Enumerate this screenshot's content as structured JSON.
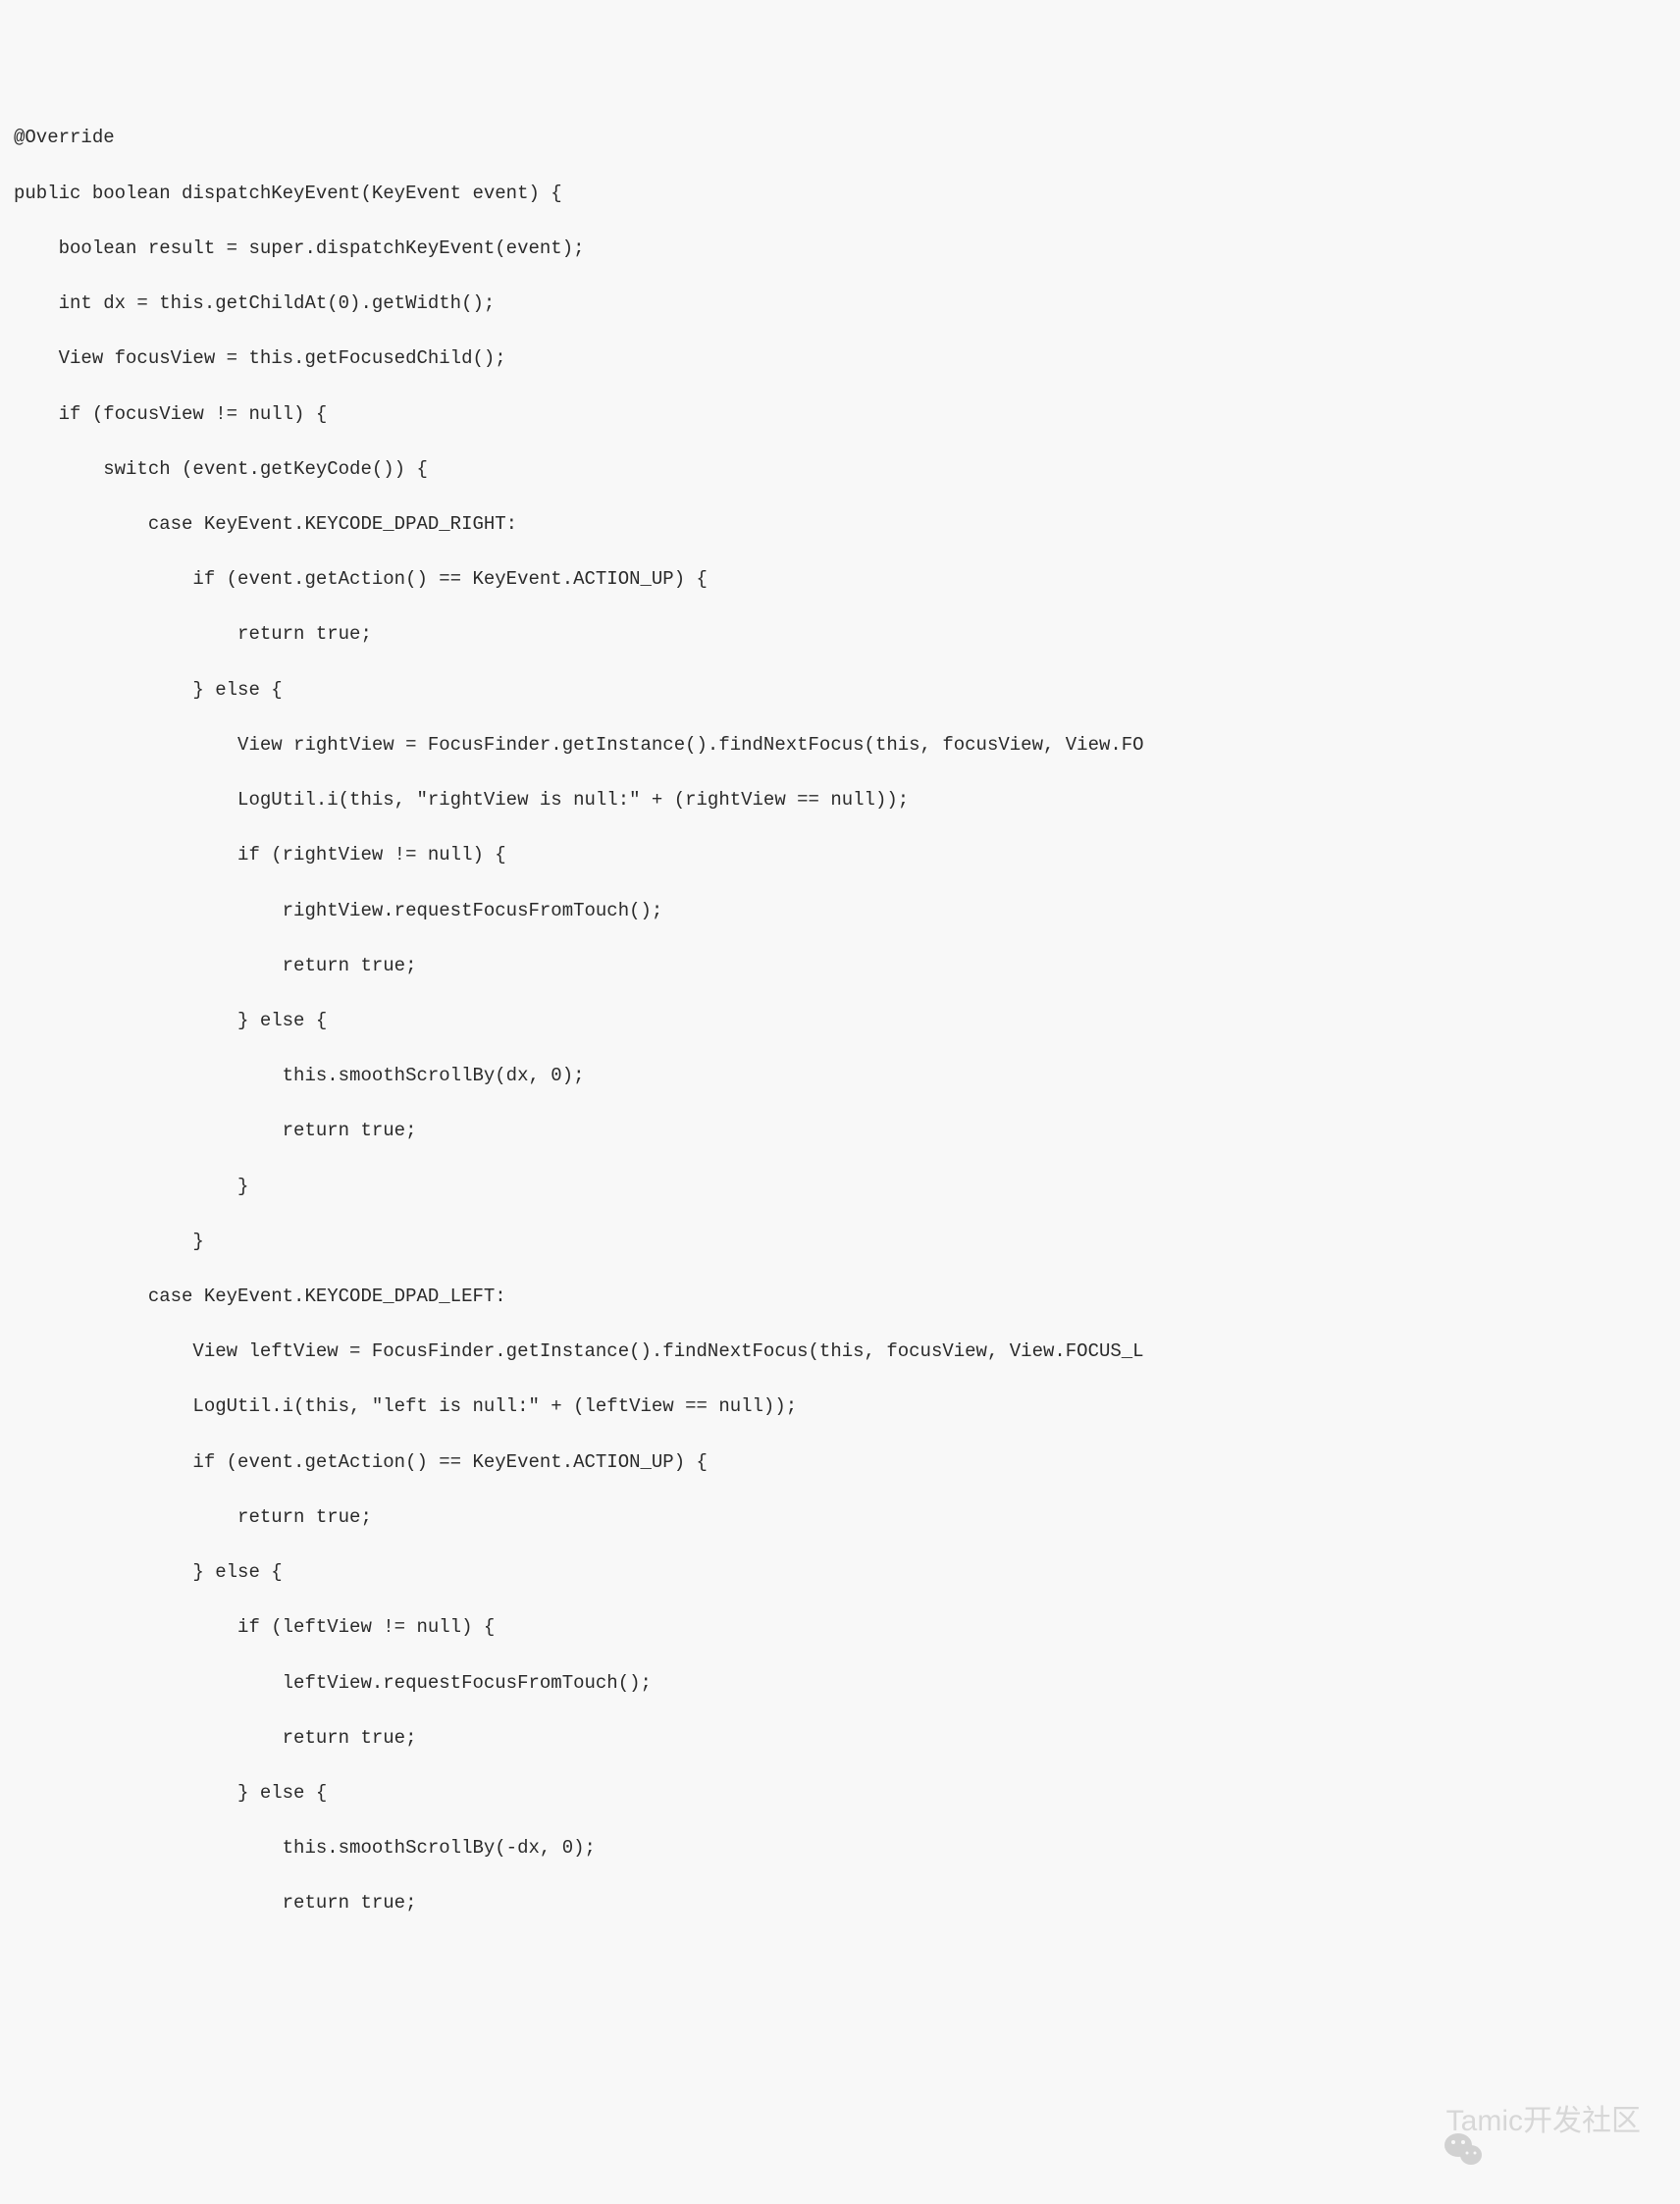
{
  "code": {
    "lines": [
      "@Override",
      "public boolean dispatchKeyEvent(KeyEvent event) {",
      "    boolean result = super.dispatchKeyEvent(event);",
      "    int dx = this.getChildAt(0).getWidth();",
      "    View focusView = this.getFocusedChild();",
      "    if (focusView != null) {",
      "        switch (event.getKeyCode()) {",
      "            case KeyEvent.KEYCODE_DPAD_RIGHT:",
      "                if (event.getAction() == KeyEvent.ACTION_UP) {",
      "                    return true;",
      "                } else {",
      "                    View rightView = FocusFinder.getInstance().findNextFocus(this, focusView, View.FO",
      "                    LogUtil.i(this, \"rightView is null:\" + (rightView == null));",
      "                    if (rightView != null) {",
      "                        rightView.requestFocusFromTouch();",
      "                        return true;",
      "                    } else {",
      "                        this.smoothScrollBy(dx, 0);",
      "                        return true;",
      "                    }",
      "                }",
      "            case KeyEvent.KEYCODE_DPAD_LEFT:",
      "                View leftView = FocusFinder.getInstance().findNextFocus(this, focusView, View.FOCUS_L",
      "                LogUtil.i(this, \"left is null:\" + (leftView == null));",
      "                if (event.getAction() == KeyEvent.ACTION_UP) {",
      "                    return true;",
      "                } else {",
      "                    if (leftView != null) {",
      "                        leftView.requestFocusFromTouch();",
      "                        return true;",
      "                    } else {",
      "                        this.smoothScrollBy(-dx, 0);",
      "                        return true;"
    ]
  },
  "watermark": {
    "text": "Tamic开发社区"
  }
}
